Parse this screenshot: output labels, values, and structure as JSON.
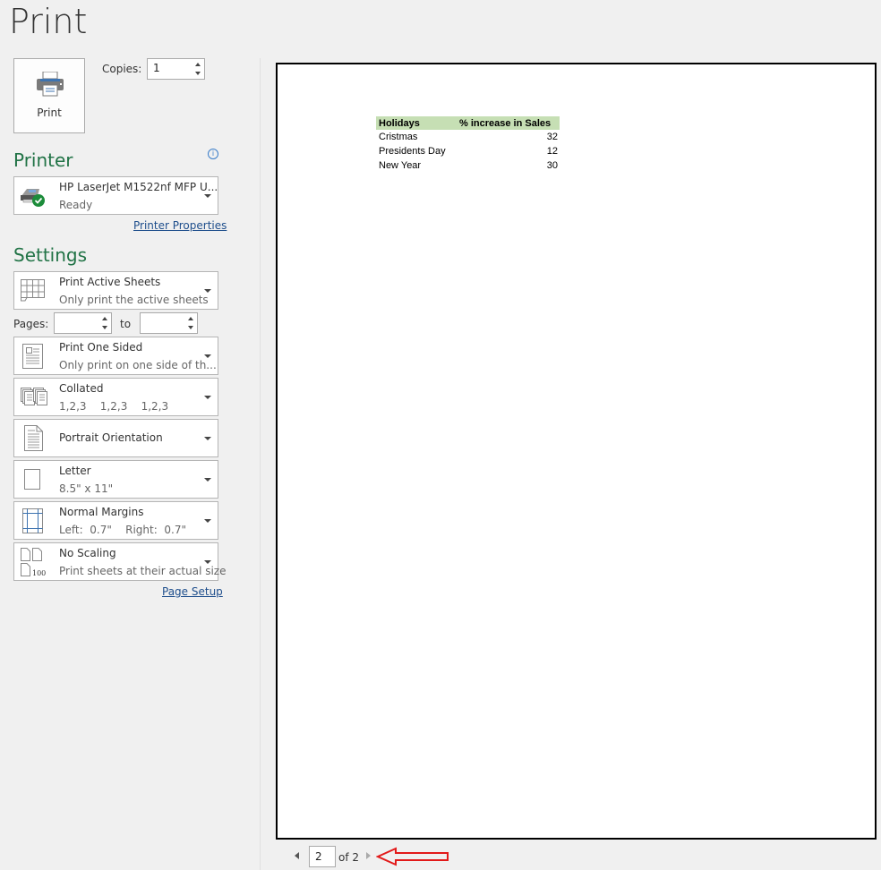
{
  "title": "Print",
  "print_button": {
    "label": "Print"
  },
  "copies": {
    "label": "Copies:",
    "value": "1"
  },
  "printer": {
    "heading": "Printer",
    "name": "HP LaserJet M1522nf MFP U...",
    "status": "Ready",
    "properties_link": "Printer Properties",
    "info_icon": "i"
  },
  "settings": {
    "heading": "Settings",
    "items": [
      {
        "title": "Print Active Sheets",
        "subtitle": "Only print the active sheets",
        "icon": "sheet-grid-icon"
      },
      {
        "title": "Print One Sided",
        "subtitle": "Only print on one side of th...",
        "icon": "one-sided-page-icon"
      },
      {
        "title": "Collated",
        "subtitle": "1,2,3    1,2,3    1,2,3",
        "icon": "collated-icon"
      },
      {
        "title": "Portrait Orientation",
        "subtitle": "",
        "icon": "portrait-page-icon"
      },
      {
        "title": "Letter",
        "subtitle": "8.5\" x 11\"",
        "icon": "paper-size-icon"
      },
      {
        "title": "Normal Margins",
        "subtitle": "Left:  0.7\"    Right:  0.7\"",
        "icon": "margins-icon"
      },
      {
        "title": "No Scaling",
        "subtitle": "Print sheets at their actual size",
        "icon": "scaling-icon"
      }
    ],
    "pages": {
      "label": "Pages:",
      "from": "",
      "to_label": "to",
      "to": ""
    },
    "page_setup_link": "Page Setup"
  },
  "preview": {
    "table": {
      "headers": [
        "Holidays",
        "% increase in Sales"
      ],
      "rows": [
        [
          "Cristmas",
          "32"
        ],
        [
          "Presidents Day",
          "12"
        ],
        [
          "New Year",
          "30"
        ]
      ],
      "header_color": "#c6dfb4"
    },
    "navigation": {
      "current_page": "2",
      "of_label": "of 2"
    }
  },
  "annotation": {
    "arrow_color": "#e21a1a"
  }
}
